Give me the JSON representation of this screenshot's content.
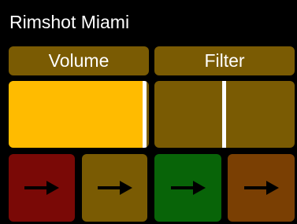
{
  "header": {
    "title": "Rimshot Miami"
  },
  "controls": [
    {
      "label": "Volume",
      "value": 0.97
    },
    {
      "label": "Filter",
      "value": 0.5
    }
  ],
  "pads": [
    {
      "icon": "right-arrow-icon",
      "color": "#7a0906"
    },
    {
      "icon": "right-arrow-icon",
      "color": "#7a5b03"
    },
    {
      "icon": "right-arrow-icon",
      "color": "#086408"
    },
    {
      "icon": "right-arrow-icon",
      "color": "#7a3f03"
    }
  ],
  "colors": {
    "panel": "#7a5b03",
    "fill": "#ffbb00",
    "handle": "#ffffff",
    "background": "#000000",
    "arrow": "#000000"
  }
}
